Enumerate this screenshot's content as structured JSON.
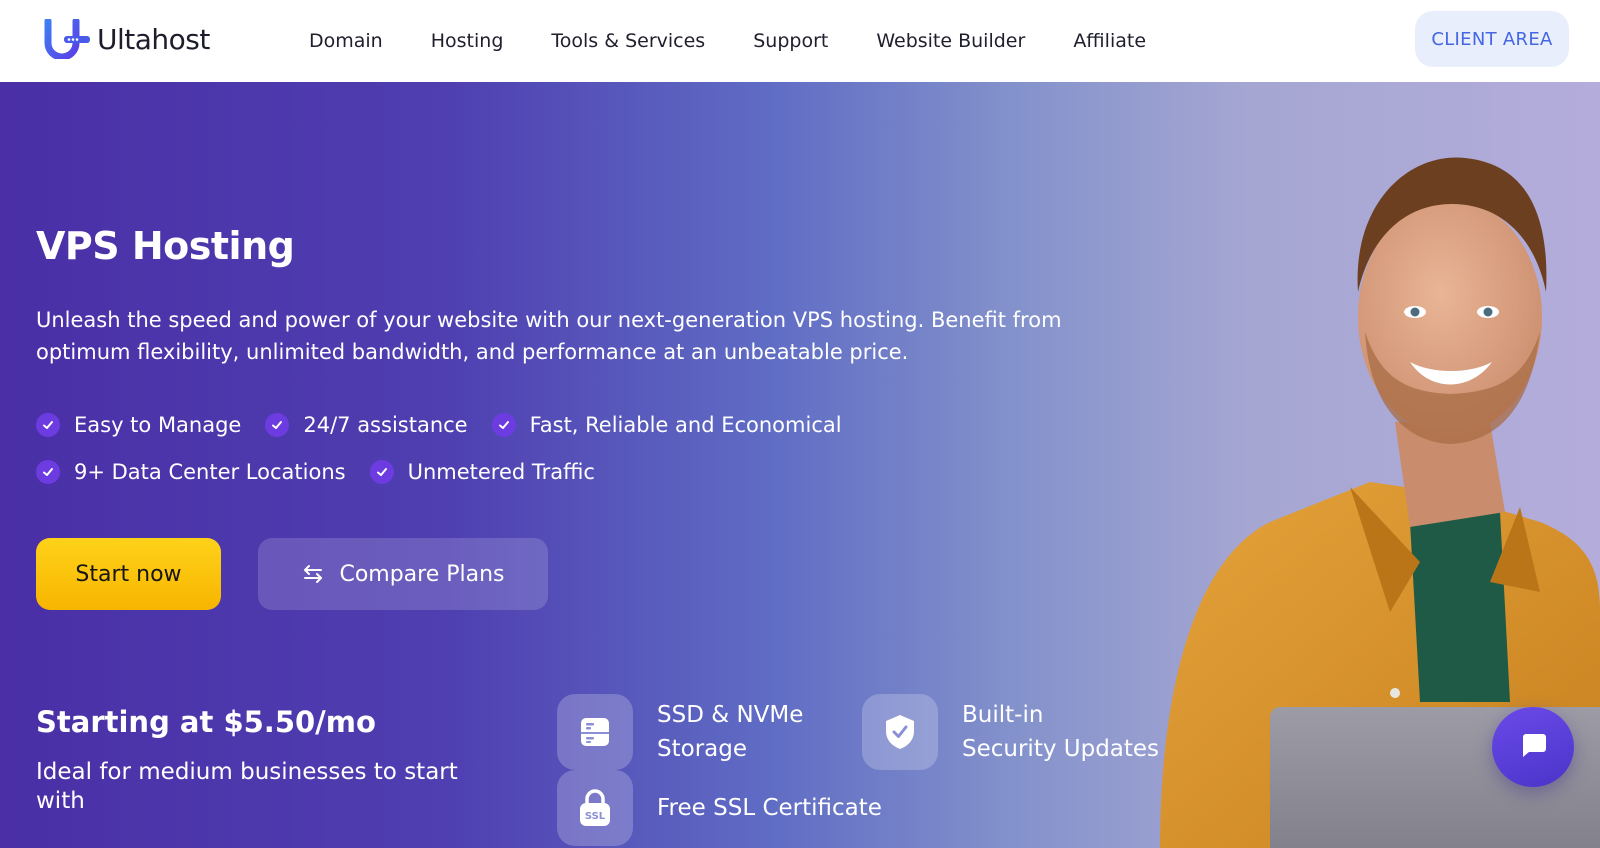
{
  "brand": {
    "name": "Ultahost",
    "accent": "#4566e2",
    "purple": "#4a2fa6",
    "yellow": "#ffc400"
  },
  "nav": {
    "items": [
      {
        "label": "Domain"
      },
      {
        "label": "Hosting"
      },
      {
        "label": "Tools & Services"
      },
      {
        "label": "Support"
      },
      {
        "label": "Website Builder"
      },
      {
        "label": "Affiliate"
      }
    ],
    "client_area": "CLIENT AREA"
  },
  "hero": {
    "title": "VPS Hosting",
    "description": "Unleash the speed and power of your website with our next-generation VPS hosting. Benefit from optimum flexibility, unlimited bandwidth, and performance at an unbeatable price.",
    "features_row1": [
      "Easy to Manage",
      "24/7 assistance",
      "Fast, Reliable and Economical"
    ],
    "features_row2": [
      "9+ Data Center Locations",
      "Unmetered Traffic"
    ],
    "buttons": {
      "start": "Start now",
      "compare": "Compare Plans"
    },
    "price_title": "Starting at $5.50/mo",
    "price_subtitle": "Ideal for medium businesses to start with",
    "perks": [
      {
        "label": "SSD & NVMe Storage",
        "line1": "SSD & NVMe",
        "line2": "Storage",
        "icon": "server-icon"
      },
      {
        "label": "Built-in Security Updates",
        "line1": "Built-in",
        "line2": "Security Updates",
        "icon": "shield-check-icon"
      },
      {
        "label": "Free SSL Certificate",
        "line1": "Free SSL Certificate",
        "line2": "",
        "icon": "ssl-lock-icon"
      }
    ]
  },
  "icons": {
    "chat": "chat-icon",
    "swap": "swap-arrows-icon",
    "check": "check-icon"
  }
}
